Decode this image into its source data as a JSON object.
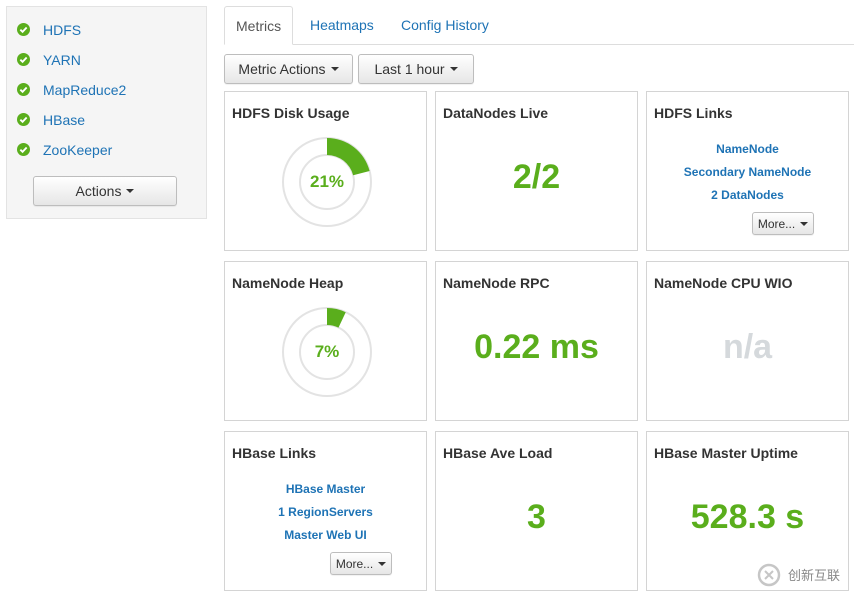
{
  "sidebar": {
    "services": [
      {
        "label": "HDFS",
        "status": "ok"
      },
      {
        "label": "YARN",
        "status": "ok"
      },
      {
        "label": "MapReduce2",
        "status": "ok"
      },
      {
        "label": "HBase",
        "status": "ok"
      },
      {
        "label": "ZooKeeper",
        "status": "ok"
      }
    ],
    "actions_label": "Actions"
  },
  "tabs": [
    {
      "label": "Metrics",
      "active": true
    },
    {
      "label": "Heatmaps",
      "active": false
    },
    {
      "label": "Config History",
      "active": false
    }
  ],
  "toolbar": {
    "metric_actions_label": "Metric Actions",
    "time_range_label": "Last 1 hour"
  },
  "widgets": {
    "hdfs_disk_usage": {
      "title": "HDFS Disk Usage",
      "value_text": "21%",
      "percent": 21
    },
    "datanodes_live": {
      "title": "DataNodes Live",
      "value": "2/2"
    },
    "hdfs_links": {
      "title": "HDFS Links",
      "links": [
        "NameNode",
        "Secondary NameNode",
        "2 DataNodes"
      ],
      "more_label": "More..."
    },
    "namenode_heap": {
      "title": "NameNode Heap",
      "value_text": "7%",
      "percent": 7
    },
    "namenode_rpc": {
      "title": "NameNode RPC",
      "value": "0.22 ms"
    },
    "namenode_cpu_wio": {
      "title": "NameNode CPU WIO",
      "value": "n/a"
    },
    "hbase_links": {
      "title": "HBase Links",
      "links": [
        "HBase Master",
        "1 RegionServers",
        "Master Web UI"
      ],
      "more_label": "More..."
    },
    "hbase_ave_load": {
      "title": "HBase Ave Load",
      "value": "3"
    },
    "hbase_master_uptime": {
      "title": "HBase Master Uptime",
      "value": "528.3 s"
    }
  },
  "watermark": {
    "text": "创新互联"
  },
  "colors": {
    "link": "#1e73b5",
    "success": "#5aae1c",
    "na": "#d5d9dc",
    "panel_bg": "#f5f5f5"
  },
  "icons": {
    "service_status": "check-circle-icon",
    "dropdown": "caret-down-icon"
  }
}
